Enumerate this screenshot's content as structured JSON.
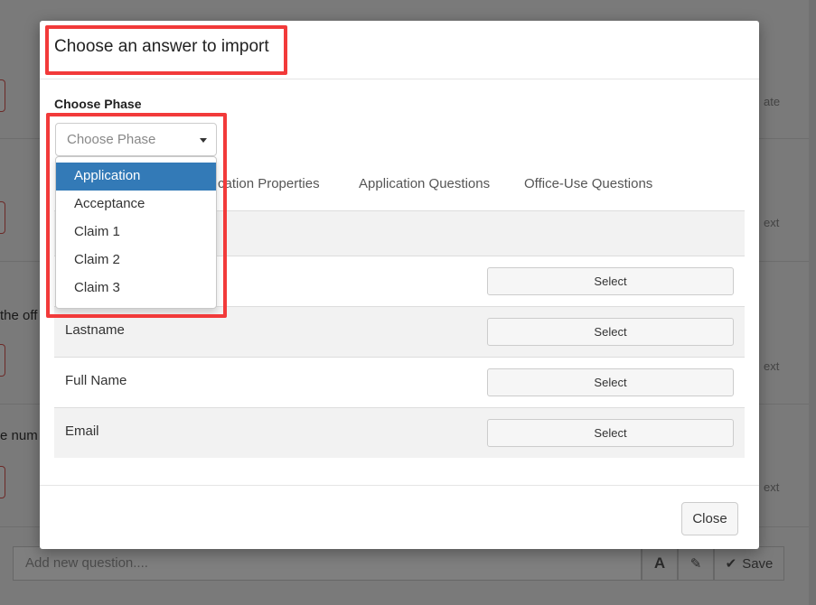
{
  "background": {
    "left_texts": [
      "the off",
      "e num"
    ],
    "right_texts": [
      "ate",
      "ext",
      "ext",
      "ext"
    ],
    "add_question_placeholder": "Add new question....",
    "save_label": "Save",
    "text_format_glyph": "A",
    "magic_glyph": "✎"
  },
  "modal": {
    "title": "Choose an answer to import",
    "phase_label": "Choose Phase",
    "phase_placeholder": "Choose Phase",
    "phase_options": [
      "Application",
      "Acceptance",
      "Claim 1",
      "Claim 2",
      "Claim 3"
    ],
    "selected_option_index": 0,
    "tabs": [
      "plication Properties",
      "Application Questions",
      "Office-Use Questions"
    ],
    "rows": [
      {
        "label": "",
        "button": "Select"
      },
      {
        "label": "Lastname",
        "button": "Select"
      },
      {
        "label": "Full Name",
        "button": "Select"
      },
      {
        "label": "Email",
        "button": "Select"
      }
    ],
    "close_label": "Close"
  },
  "colors": {
    "highlight": "#f23a3a",
    "active_option": "#337ab7"
  }
}
